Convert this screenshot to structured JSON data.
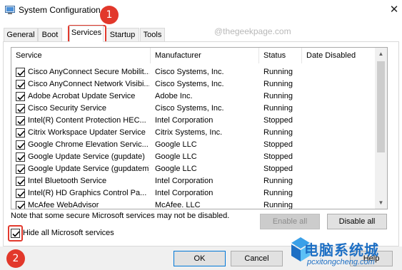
{
  "window": {
    "title": "System Configuration",
    "close_glyph": "✕"
  },
  "tabs": [
    {
      "label": "General"
    },
    {
      "label": "Boot"
    },
    {
      "label": "Services"
    },
    {
      "label": "Startup"
    },
    {
      "label": "Tools"
    }
  ],
  "active_tab": "Services",
  "annotations": {
    "marker1": "1",
    "marker2": "2",
    "accent": "#e2382b"
  },
  "watermark": {
    "top": "@thegeekpage.com",
    "cn": "电脑系统城",
    "url": "pcxitongcheng.com"
  },
  "services_table": {
    "columns": [
      "Service",
      "Manufacturer",
      "Status",
      "Date Disabled"
    ],
    "rows": [
      {
        "checked": true,
        "service": "Cisco AnyConnect Secure Mobilit...",
        "manufacturer": "Cisco Systems, Inc.",
        "status": "Running",
        "date_disabled": ""
      },
      {
        "checked": true,
        "service": "Cisco AnyConnect Network Visibi...",
        "manufacturer": "Cisco Systems, Inc.",
        "status": "Running",
        "date_disabled": ""
      },
      {
        "checked": true,
        "service": "Adobe Acrobat Update Service",
        "manufacturer": "Adobe Inc.",
        "status": "Running",
        "date_disabled": ""
      },
      {
        "checked": true,
        "service": "Cisco Security Service",
        "manufacturer": "Cisco Systems, Inc.",
        "status": "Running",
        "date_disabled": ""
      },
      {
        "checked": true,
        "service": "Intel(R) Content Protection HEC...",
        "manufacturer": "Intel Corporation",
        "status": "Stopped",
        "date_disabled": ""
      },
      {
        "checked": true,
        "service": "Citrix Workspace Updater Service",
        "manufacturer": "Citrix Systems, Inc.",
        "status": "Running",
        "date_disabled": ""
      },
      {
        "checked": true,
        "service": "Google Chrome Elevation Servic...",
        "manufacturer": "Google LLC",
        "status": "Stopped",
        "date_disabled": ""
      },
      {
        "checked": true,
        "service": "Google Update Service (gupdate)",
        "manufacturer": "Google LLC",
        "status": "Stopped",
        "date_disabled": ""
      },
      {
        "checked": true,
        "service": "Google Update Service (gupdatem)",
        "manufacturer": "Google LLC",
        "status": "Stopped",
        "date_disabled": ""
      },
      {
        "checked": true,
        "service": "Intel Bluetooth Service",
        "manufacturer": "Intel Corporation",
        "status": "Running",
        "date_disabled": ""
      },
      {
        "checked": true,
        "service": "Intel(R) HD Graphics Control Pa...",
        "manufacturer": "Intel Corporation",
        "status": "Running",
        "date_disabled": ""
      },
      {
        "checked": true,
        "service": "McAfee WebAdvisor",
        "manufacturer": "McAfee. LLC",
        "status": "Running",
        "date_disabled": ""
      }
    ]
  },
  "note": "Note that some secure Microsoft services may not be disabled.",
  "buttons": {
    "enable_all": "Enable all",
    "disable_all": "Disable all",
    "ok": "OK",
    "cancel": "Cancel",
    "help": "Help"
  },
  "hide_ms": {
    "label": "Hide all Microsoft services",
    "checked": true
  }
}
